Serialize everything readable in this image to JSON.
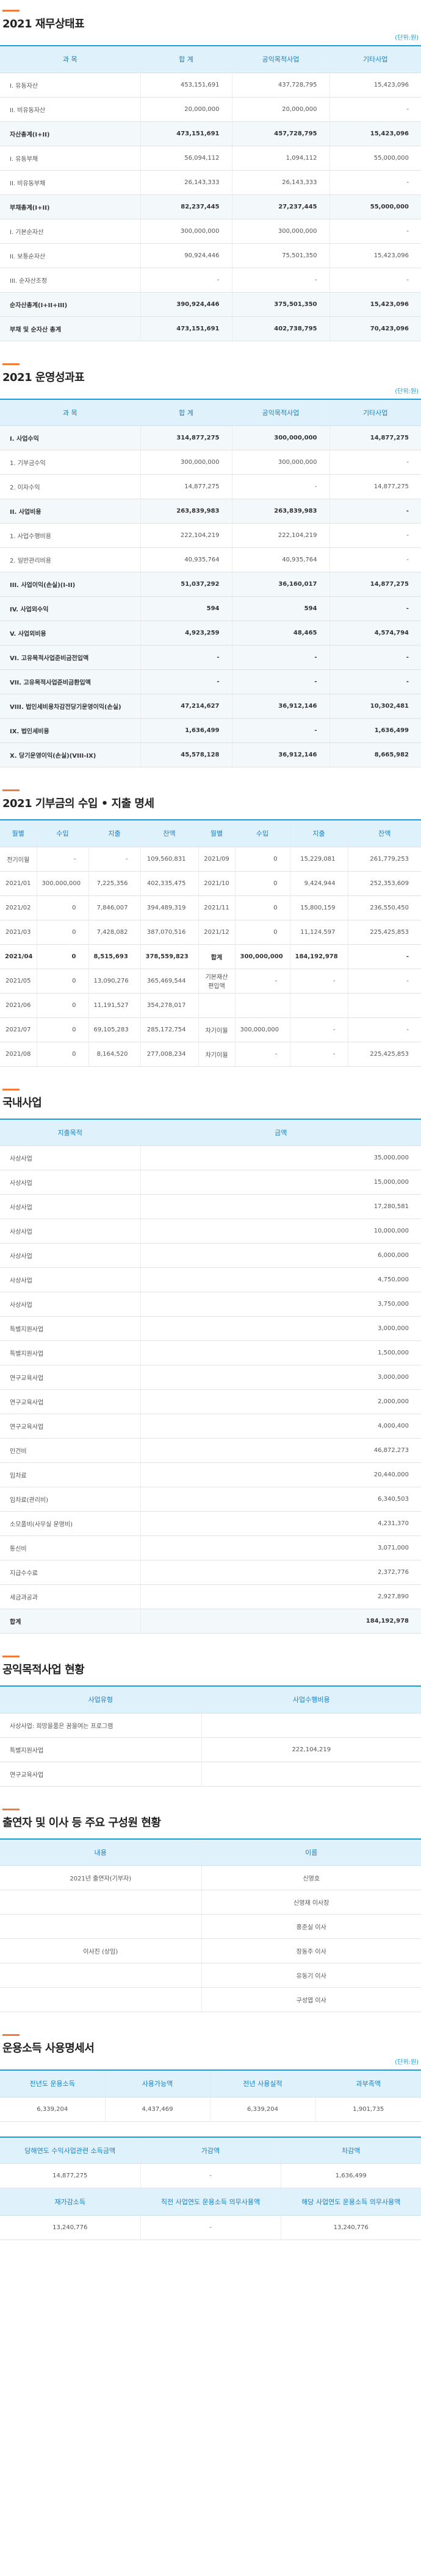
{
  "s1": {
    "title": "2021 재무상태표",
    "unit": "(단위:원)",
    "headers": [
      "과 목",
      "합 계",
      "공익목적사업",
      "기타사업"
    ],
    "rows": [
      {
        "cells": [
          "I. 유동자산",
          "453,151,691",
          "437,728,795",
          "15,423,096"
        ]
      },
      {
        "cells": [
          "II. 비유동자산",
          "20,000,000",
          "20,000,000",
          "-"
        ]
      },
      {
        "cells": [
          "자산총계(I+II)",
          "473,151,691",
          "457,728,795",
          "15,423,096"
        ],
        "bold": true
      },
      {
        "cells": [
          "I. 유동부채",
          "56,094,112",
          "1,094,112",
          "55,000,000"
        ]
      },
      {
        "cells": [
          "II. 비유동부채",
          "26,143,333",
          "26,143,333",
          "-"
        ]
      },
      {
        "cells": [
          "부채총계(I+II)",
          "82,237,445",
          "27,237,445",
          "55,000,000"
        ],
        "bold": true
      },
      {
        "cells": [
          "I. 기본순자산",
          "300,000,000",
          "300,000,000",
          "-"
        ]
      },
      {
        "cells": [
          "II. 보통순자산",
          "90,924,446",
          "75,501,350",
          "15,423,096"
        ]
      },
      {
        "cells": [
          "III. 순자산조정",
          "-",
          "-",
          "-"
        ]
      },
      {
        "cells": [
          "순자산총계(I+II+III)",
          "390,924,446",
          "375,501,350",
          "15,423,096"
        ],
        "bold": true
      },
      {
        "cells": [
          "부채 및 순자산 총계",
          "473,151,691",
          "402,738,795",
          "70,423,096"
        ],
        "bold": true
      }
    ]
  },
  "s2": {
    "title": "2021 운영성과표",
    "unit": "(단위:원)",
    "headers": [
      "과 목",
      "합 계",
      "공익목적사업",
      "기타사업"
    ],
    "rows": [
      {
        "cells": [
          "I. 사업수익",
          "314,877,275",
          "300,000,000",
          "14,877,275"
        ],
        "bold": true
      },
      {
        "cells": [
          "1. 기부금수익",
          "300,000,000",
          "300,000,000",
          "-"
        ]
      },
      {
        "cells": [
          "2. 이자수익",
          "14,877,275",
          "-",
          "14,877,275"
        ]
      },
      {
        "cells": [
          "II. 사업비용",
          "263,839,983",
          "263,839,983",
          "-"
        ],
        "bold": true
      },
      {
        "cells": [
          "1. 사업수행비용",
          "222,104,219",
          "222,104,219",
          "-"
        ]
      },
      {
        "cells": [
          "2. 일반관리비용",
          "40,935,764",
          "40,935,764",
          "-"
        ]
      },
      {
        "cells": [
          "III. 사업이익(손실)(I-II)",
          "51,037,292",
          "36,160,017",
          "14,877,275"
        ],
        "bold": true
      },
      {
        "cells": [
          "IV. 사업외수익",
          "594",
          "594",
          "-"
        ],
        "bold": true
      },
      {
        "cells": [
          "V. 사업외비용",
          "4,923,259",
          "48,465",
          "4,574,794"
        ],
        "bold": true
      },
      {
        "cells": [
          "VI. 고유목적사업준비금전입액",
          "-",
          "-",
          "-"
        ],
        "bold": true
      },
      {
        "cells": [
          "VII. 고유목적사업준비금환입액",
          "-",
          "-",
          "-"
        ],
        "bold": true
      },
      {
        "cells": [
          "VIII. 법인세비용차감전당기운영이익(손실)",
          "47,214,627",
          "36,912,146",
          "10,302,481"
        ],
        "bold": true
      },
      {
        "cells": [
          "IX. 법인세비용",
          "1,636,499",
          "-",
          "1,636,499"
        ],
        "bold": true
      },
      {
        "cells": [
          "X. 당기운영이익(손실)(VIII-IX)",
          "45,578,128",
          "36,912,146",
          "8,665,982"
        ],
        "bold": true
      }
    ]
  },
  "s3": {
    "title": "2021 기부금의 수입 • 지출 명세",
    "headers": [
      "월별",
      "수입",
      "지출",
      "잔액",
      "월별",
      "수입",
      "지출",
      "잔액"
    ],
    "rows": [
      {
        "cells": [
          "전기이월",
          "-",
          "-",
          "109,560,831",
          "2021/09",
          "0",
          "15,229,081",
          "261,779,253"
        ]
      },
      {
        "cells": [
          "2021/01",
          "300,000,000",
          "7,225,356",
          "402,335,475",
          "2021/10",
          "0",
          "9,424,944",
          "252,353,609"
        ]
      },
      {
        "cells": [
          "2021/02",
          "0",
          "7,846,007",
          "394,489,319",
          "2021/11",
          "0",
          "15,800,159",
          "236,550,450"
        ]
      },
      {
        "cells": [
          "2021/03",
          "0",
          "7,428,082",
          "387,070,516",
          "2021/12",
          "0",
          "11,124,597",
          "225,425,853"
        ]
      },
      {
        "cells": [
          "2021/04",
          "0",
          "8,515,693",
          "378,559,823",
          "합계",
          "300,000,000",
          "184,192,978",
          "-"
        ],
        "hl": true
      },
      {
        "cells": [
          "2021/05",
          "0",
          "13,090,276",
          "365,469,544",
          "기본재산 편입액",
          "-",
          "-",
          "-"
        ]
      },
      {
        "cells": [
          "2021/06",
          "0",
          "11,191,527",
          "354,278,017",
          "",
          "",
          "",
          ""
        ]
      },
      {
        "cells": [
          "2021/07",
          "0",
          "69,105,283",
          "285,172,754",
          "차기이월",
          "300,000,000",
          "-",
          "-"
        ]
      },
      {
        "cells": [
          "2021/08",
          "0",
          "8,164,520",
          "277,008,234",
          "차기이월",
          "-",
          "-",
          "225,425,853"
        ]
      }
    ]
  },
  "s4": {
    "title": "국내사업",
    "headers": [
      "지출목적",
      "금액"
    ],
    "rows": [
      {
        "cells": [
          "사상사업",
          "35,000,000"
        ]
      },
      {
        "cells": [
          "사상사업",
          "15,000,000"
        ]
      },
      {
        "cells": [
          "사상사업",
          "17,280,581"
        ]
      },
      {
        "cells": [
          "사상사업",
          "10,000,000"
        ]
      },
      {
        "cells": [
          "사상사업",
          "6,000,000"
        ]
      },
      {
        "cells": [
          "사상사업",
          "4,750,000"
        ]
      },
      {
        "cells": [
          "사상사업",
          "3,750,000"
        ]
      },
      {
        "cells": [
          "특별지원사업",
          "3,000,000"
        ]
      },
      {
        "cells": [
          "특별지원사업",
          "1,500,000"
        ]
      },
      {
        "cells": [
          "연구교육사업",
          "3,000,000"
        ]
      },
      {
        "cells": [
          "연구교육사업",
          "2,000,000"
        ]
      },
      {
        "cells": [
          "연구교육사업",
          "4,000,400"
        ]
      },
      {
        "cells": [
          "인건비",
          "46,872,273"
        ]
      },
      {
        "cells": [
          "임차료",
          "20,440,000"
        ]
      },
      {
        "cells": [
          "임차료(관리비)",
          "6,340,503"
        ]
      },
      {
        "cells": [
          "소모품비(사무실 운영비)",
          "4,231,370"
        ]
      },
      {
        "cells": [
          "통신비",
          "3,071,000"
        ]
      },
      {
        "cells": [
          "지급수수료",
          "2,372,776"
        ]
      },
      {
        "cells": [
          "세금과공과",
          "2,927,890"
        ]
      },
      {
        "cells": [
          "합계",
          "184,192,978"
        ],
        "bold": true
      }
    ]
  },
  "s5": {
    "title": "공익목적사업 현황",
    "headers": [
      "사업유형",
      "사업수행비용"
    ],
    "rows": [
      {
        "cells": [
          "사상사업: 희망을품은 꿈을여는 프로그램",
          ""
        ]
      },
      {
        "cells": [
          "특별지원사업",
          "222,104,219"
        ]
      },
      {
        "cells": [
          "연구교육사업",
          ""
        ]
      }
    ]
  },
  "s6": {
    "title": "출연자 및 이사 등 주요 구성원 현황",
    "headers": [
      "내용",
      "이름"
    ],
    "rows": [
      {
        "cells": [
          "2021년 출연자(기부자)",
          "신영호"
        ]
      },
      {
        "cells": [
          "",
          "신영재 이사장"
        ]
      },
      {
        "cells": [
          "",
          "홍준실 이사"
        ]
      },
      {
        "cells": [
          "이사진 (상임)",
          "장동주 이사"
        ]
      },
      {
        "cells": [
          "",
          "유동기 이사"
        ]
      },
      {
        "cells": [
          "",
          "구성엽 이사"
        ]
      }
    ]
  },
  "s7": {
    "title": "운용소득 사용명세서",
    "unit": "(단위:원)",
    "t1_headers": [
      "전년도 운용소득",
      "사용가능액",
      "전년 사용실적",
      "과부족액"
    ],
    "t1_row": [
      "6,339,204",
      "4,437,469",
      "6,339,204",
      "1,901,735"
    ],
    "t2_headers": [
      "당해연도 수익사업관련 소득금액",
      "가감액",
      "차감액"
    ],
    "t2_row": [
      "14,877,275",
      "-",
      "1,636,499"
    ],
    "t3_headers": [
      "재가감소득",
      "직전 사업연도 운용소득 의무사용액",
      "해당 사업연도 운용소득 의무사용액"
    ],
    "t3_row": [
      "13,240,776",
      "-",
      "13,240,776"
    ]
  }
}
